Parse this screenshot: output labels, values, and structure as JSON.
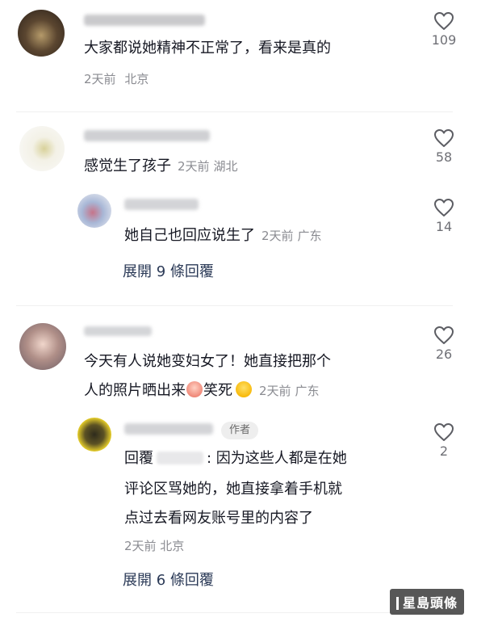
{
  "comments": [
    {
      "text": "大家都说她精神不正常了，看来是真的",
      "time": "2天前",
      "location": "北京",
      "likes": "109"
    },
    {
      "text": "感觉生了孩子",
      "time": "2天前",
      "location": "湖北",
      "likes": "58",
      "reply": {
        "text": "她自己也回应说生了",
        "time": "2天前",
        "location": "广东",
        "likes": "14"
      },
      "expand_label": "展開 9 條回覆"
    },
    {
      "text_line1": "今天有人说她变妇女了！她直接把那个",
      "text_line2_a": "人的照片晒出来",
      "text_line2_b": "笑死",
      "time": "2天前",
      "location": "广东",
      "likes": "26",
      "reply": {
        "author_badge": "作者",
        "prefix": "回覆",
        "line1_rest": ": 因为这些人都是在她",
        "line2": "评论区骂她的，她直接拿着手机就",
        "line3": "点过去看网友账号里的内容了",
        "meta": "2天前 北京",
        "likes": "2"
      },
      "expand_label": "展開 6 條回覆"
    }
  ],
  "watermark": "星島頭條",
  "colors": {
    "text": "#161823",
    "meta": "#8a8b91",
    "expand": "#2b3a57",
    "like_outline": "#5c5d63"
  }
}
